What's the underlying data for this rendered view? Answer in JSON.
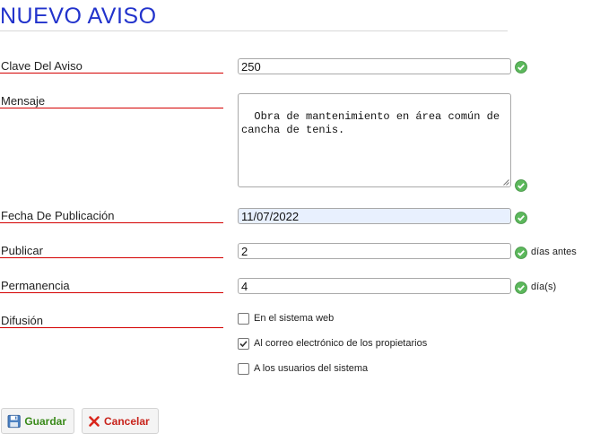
{
  "page": {
    "title": "NUEVO AVISO"
  },
  "form": {
    "clave": {
      "label": "Clave Del Aviso",
      "value": "250"
    },
    "mensaje": {
      "label": "Mensaje",
      "value": "Obra de mantenimiento en área común de\ncancha de tenis."
    },
    "fecha": {
      "label": "Fecha De Publicación",
      "value": "11/07/2022"
    },
    "publicar": {
      "label": "Publicar",
      "value": "2",
      "unit": "días antes"
    },
    "permanencia": {
      "label": "Permanencia",
      "value": "4",
      "unit": "día(s)"
    },
    "difusion": {
      "label": "Difusión",
      "options": [
        {
          "label": "En el sistema web",
          "checked": false
        },
        {
          "label": "Al correo electrónico de los propietarios",
          "checked": true
        },
        {
          "label": "A los usuarios del sistema",
          "checked": false
        }
      ]
    }
  },
  "actions": {
    "save_label": "Guardar",
    "cancel_label": "Cancelar"
  },
  "colors": {
    "title": "#2233cc",
    "label_rule": "#d40000",
    "valid": "#5cb85c",
    "save": "#3a8a1a",
    "cancel": "#c8231b"
  },
  "icons": {
    "valid": "check-circle-icon",
    "save": "floppy-disk-icon",
    "cancel": "x-icon"
  }
}
